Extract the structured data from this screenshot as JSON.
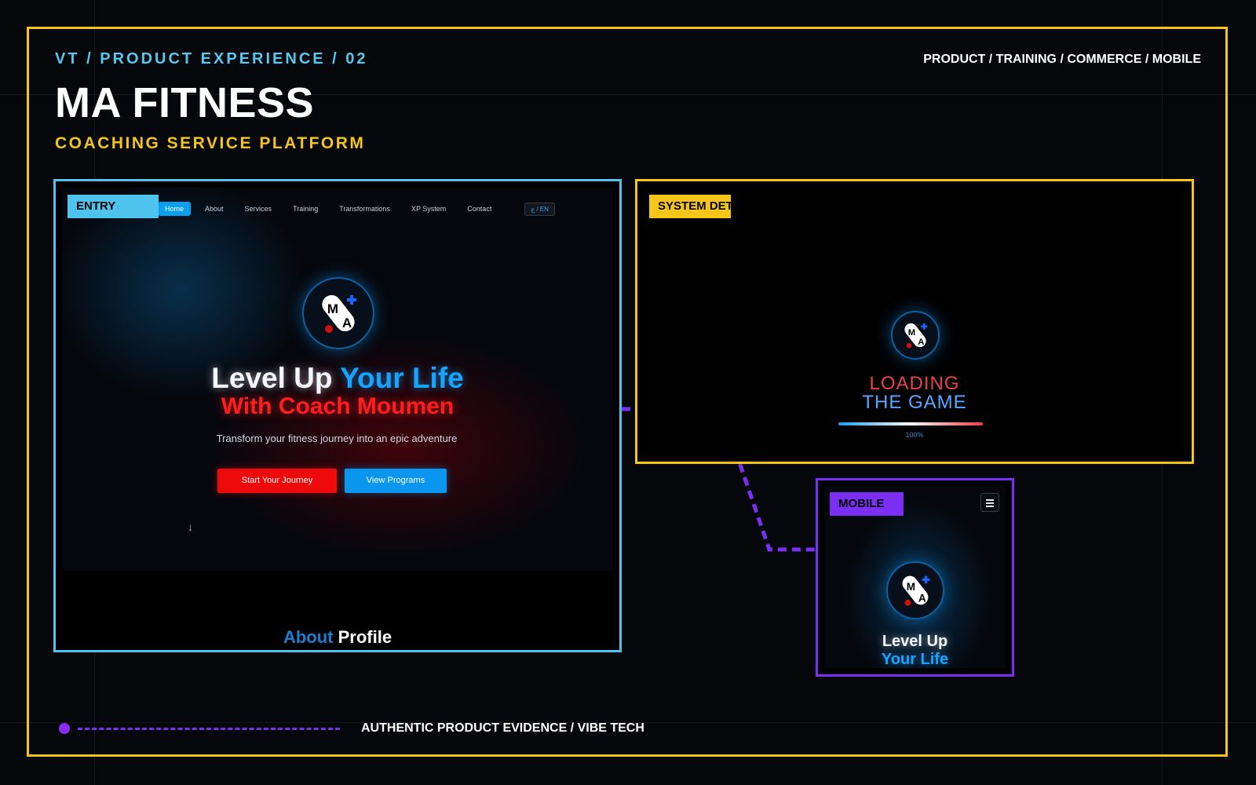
{
  "header": {
    "kicker": "VT / PRODUCT EXPERIENCE / 02",
    "tags": "PRODUCT / TRAINING / COMMERCE / MOBILE",
    "title": "MA FITNESS",
    "subtitle": "COACHING SERVICE PLATFORM"
  },
  "colors": {
    "frame": "#f5c518",
    "entry_accent": "#4ec3ee",
    "system_accent": "#f5c518",
    "mobile_accent": "#7b2ff5",
    "hero_blue": "#16a4ff",
    "hero_red": "#ff1c1c"
  },
  "entry": {
    "label": "ENTRY",
    "nav": [
      {
        "label": "Home",
        "active": true
      },
      {
        "label": "About"
      },
      {
        "label": "Services"
      },
      {
        "label": "Training"
      },
      {
        "label": "Transformations"
      },
      {
        "label": "XP System"
      },
      {
        "label": "Contact"
      }
    ],
    "language": "ع / EN",
    "logo_letters": [
      "M",
      "A"
    ],
    "hero": {
      "line1_white": "Level Up",
      "line1_blue": "Your Life",
      "line2": "With Coach Moumen",
      "description": "Transform your fitness journey into an epic adventure",
      "primary_button": "Start Your Journey",
      "secondary_button": "View Programs",
      "scroll_icon": "arrow-down-icon",
      "about_blue": "About",
      "about_white": "Profile"
    }
  },
  "system": {
    "label": "SYSTEM DET",
    "loading_line1": "LOADING",
    "loading_line2": "THE GAME",
    "progress_percent": 100,
    "progress_text": "100%"
  },
  "mobile": {
    "label": "MOBILE",
    "menu_icon": "hamburger-menu-icon",
    "line1": "Level Up",
    "line2": "Your Life"
  },
  "footer": {
    "text": "AUTHENTIC PRODUCT EVIDENCE / VIBE TECH"
  }
}
